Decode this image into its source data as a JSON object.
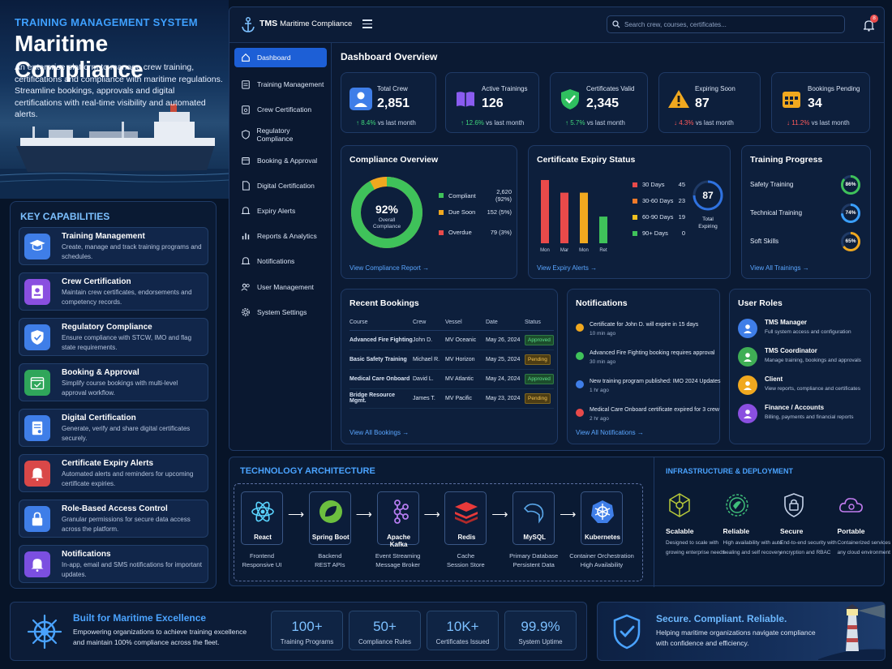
{
  "hero": {
    "subtitle": "TRAINING MANAGEMENT SYSTEM",
    "title": "Maritime Compliance",
    "description": "An enterprise platform to manage crew training, certifications and compliance with maritime regulations. Streamline bookings, approvals and digital certifications with real-time visibility and automated alerts."
  },
  "capabilities": {
    "title": "KEY CAPABILITIES",
    "items": [
      {
        "title": "Training Management",
        "desc": "Create, manage and track training programs and schedules.",
        "icon": "graduation-cap-icon",
        "color": "#3f7ee8"
      },
      {
        "title": "Crew Certification",
        "desc": "Maintain crew certificates, endorsements and competency records.",
        "icon": "id-card-icon",
        "color": "#8a4fe0"
      },
      {
        "title": "Regulatory Compliance",
        "desc": "Ensure compliance with STCW, IMO and flag state requirements.",
        "icon": "shield-check-icon",
        "color": "#3f7ee8"
      },
      {
        "title": "Booking & Approval",
        "desc": "Simplify course bookings with multi-level approval workflow.",
        "icon": "calendar-check-icon",
        "color": "#2fa65a"
      },
      {
        "title": "Digital Certification",
        "desc": "Generate, verify and share digital certificates securely.",
        "icon": "certificate-icon",
        "color": "#3f7ee8"
      },
      {
        "title": "Certificate Expiry Alerts",
        "desc": "Automated alerts and reminders for upcoming certificate expiries.",
        "icon": "bell-icon",
        "color": "#d94848"
      },
      {
        "title": "Role-Based Access Control",
        "desc": "Granular permissions for secure data access across the platform.",
        "icon": "lock-icon",
        "color": "#3f7ee8"
      },
      {
        "title": "Notifications",
        "desc": "In-app, email and SMS notifications for important updates.",
        "icon": "bell-icon",
        "color": "#7b4fe0"
      }
    ]
  },
  "app": {
    "brand_prefix": "TMS",
    "brand": "Maritime Compliance",
    "search_placeholder": "Search crew, courses, certificates...",
    "notification_count": "8",
    "nav": [
      {
        "label": "Dashboard",
        "icon": "home-icon",
        "active": true
      },
      {
        "label": "Training Management",
        "icon": "clipboard-icon"
      },
      {
        "label": "Crew Certification",
        "icon": "certificate-icon"
      },
      {
        "label": "Regulatory Compliance",
        "icon": "shield-icon"
      },
      {
        "label": "Booking & Approval",
        "icon": "calendar-icon"
      },
      {
        "label": "Digital Certification",
        "icon": "document-icon"
      },
      {
        "label": "Expiry Alerts",
        "icon": "bell-icon"
      },
      {
        "label": "Reports & Analytics",
        "icon": "bar-chart-icon"
      },
      {
        "label": "Notifications",
        "icon": "bell-icon"
      },
      {
        "label": "User Management",
        "icon": "users-icon"
      },
      {
        "label": "System Settings",
        "icon": "gear-icon"
      }
    ],
    "dashboard_title": "Dashboard Overview",
    "stats": [
      {
        "label": "Total Crew",
        "value": "2,851",
        "delta": "8.4%",
        "dir": "up",
        "suffix": "vs last month",
        "icon": "user-icon",
        "color": "#3f7ee8"
      },
      {
        "label": "Active Trainings",
        "value": "126",
        "delta": "12.6%",
        "dir": "up",
        "suffix": "vs last month",
        "icon": "book-icon",
        "color": "#8a5cf0"
      },
      {
        "label": "Certificates Valid",
        "value": "2,345",
        "delta": "5.7%",
        "dir": "up",
        "suffix": "vs last month",
        "icon": "shield-check-icon",
        "color": "#2fbf5f"
      },
      {
        "label": "Expiring Soon",
        "value": "87",
        "delta": "4.3%",
        "dir": "down",
        "suffix": "vs last month",
        "icon": "warning-icon",
        "color": "#f0a81f"
      },
      {
        "label": "Bookings Pending",
        "value": "34",
        "delta": "11.2%",
        "dir": "down",
        "suffix": "vs last month",
        "icon": "calendar-icon",
        "color": "#f0a81f"
      }
    ],
    "compliance": {
      "title": "Compliance Overview",
      "percent": "92%",
      "center_label_1": "Overall",
      "center_label_2": "Compliance",
      "link": "View Compliance Report",
      "legend": [
        {
          "label": "Compliant",
          "value": "2,620 (92%)",
          "color": "#3fc25a"
        },
        {
          "label": "Due Soon",
          "value": "152 (5%)",
          "color": "#f0a81f"
        },
        {
          "label": "Overdue",
          "value": "79 (3%)",
          "color": "#e84a4a"
        }
      ]
    },
    "expiry": {
      "title": "Certificate Expiry Status",
      "total": "87",
      "total_label_1": "Total",
      "total_label_2": "Expiring",
      "link": "View Expiry Alerts",
      "bars": [
        {
          "tick": "Mon",
          "value": 45,
          "color": "#e84a4a"
        },
        {
          "tick": "Mar",
          "value": 36,
          "color": "#e84a4a"
        },
        {
          "tick": "Mon",
          "value": 36,
          "color": "#f0a81f"
        },
        {
          "tick": "Ret",
          "value": 19,
          "color": "#3fc25a"
        }
      ],
      "legend": [
        {
          "label": "30 Days",
          "value": "45",
          "color": "#e84a4a"
        },
        {
          "label": "30-60 Days",
          "value": "23",
          "color": "#f07a2a"
        },
        {
          "label": "60-90 Days",
          "value": "19",
          "color": "#f0c020"
        },
        {
          "label": "90+ Days",
          "value": "0",
          "color": "#3fc25a"
        }
      ]
    },
    "training_progress": {
      "title": "Training Progress",
      "link": "View All Trainings",
      "items": [
        {
          "label": "Safety Training",
          "percent": "86%",
          "fraction": 0.86,
          "color": "#3fc25a"
        },
        {
          "label": "Technical Training",
          "percent": "74%",
          "fraction": 0.74,
          "color": "#3aa0ff"
        },
        {
          "label": "Soft Skills",
          "percent": "65%",
          "fraction": 0.65,
          "color": "#f0a81f"
        }
      ]
    },
    "bookings": {
      "title": "Recent Bookings",
      "link": "View All Bookings",
      "headers": [
        "Course",
        "Crew",
        "Vessel",
        "Date",
        "Status"
      ],
      "rows": [
        {
          "course": "Advanced Fire Fighting",
          "crew": "John D.",
          "vessel": "MV Oceanic",
          "date": "May 26, 2024",
          "status": "Approved"
        },
        {
          "course": "Basic Safety Training",
          "crew": "Michael R.",
          "vessel": "MV Horizon",
          "date": "May 25, 2024",
          "status": "Pending"
        },
        {
          "course": "Medical Care Onboard",
          "crew": "David L.",
          "vessel": "MV Atlantic",
          "date": "May 24, 2024",
          "status": "Approved"
        },
        {
          "course": "Bridge Resource Mgmt.",
          "crew": "James T.",
          "vessel": "MV Pacific",
          "date": "May 23, 2024",
          "status": "Pending"
        }
      ]
    },
    "notifications": {
      "title": "Notifications",
      "link": "View All Notifications",
      "items": [
        {
          "text": "Certificate for John D. will expire in 15 days",
          "time": "10 min ago",
          "color": "#f0a81f"
        },
        {
          "text": "Advanced Fire Fighting booking requires approval",
          "time": "30 min ago",
          "color": "#3fc25a"
        },
        {
          "text": "New training program published: IMO 2024 Updates",
          "time": "1 hr ago",
          "color": "#3f7ee8"
        },
        {
          "text": "Medical Care Onboard certificate expired for 3 crew",
          "time": "2 hr ago",
          "color": "#e84a4a"
        }
      ]
    },
    "roles": {
      "title": "User Roles",
      "items": [
        {
          "title": "TMS Manager",
          "desc": "Full system access and configuration",
          "color": "#3f7ee8"
        },
        {
          "title": "TMS Coordinator",
          "desc": "Manage training, bookings and approvals",
          "color": "#3fae55"
        },
        {
          "title": "Client",
          "desc": "View reports, compliance and certificates",
          "color": "#f0a81f"
        },
        {
          "title": "Finance / Accounts",
          "desc": "Billing, payments and financial reports",
          "color": "#8a4fe0"
        }
      ]
    }
  },
  "tech": {
    "title": "TECHNOLOGY ARCHITECTURE",
    "items": [
      {
        "name": "React",
        "line1": "Frontend",
        "line2": "Responsive UI",
        "icon": "react-icon",
        "color": "#5ad4ff"
      },
      {
        "name": "Spring Boot",
        "line1": "Backend",
        "line2": "REST APIs",
        "icon": "spring-leaf-icon",
        "color": "#6cbf3f"
      },
      {
        "name": "Apache Kafka",
        "line1": "Event Streaming",
        "line2": "Message Broker",
        "icon": "kafka-icon",
        "color": "#b57cf0"
      },
      {
        "name": "Redis",
        "line1": "Cache",
        "line2": "Session Store",
        "icon": "redis-icon",
        "color": "#e83a3a"
      },
      {
        "name": "MySQL",
        "line1": "Primary Database",
        "line2": "Persistent Data",
        "icon": "dolphin-icon",
        "color": "#5aa6e8"
      },
      {
        "name": "Kubernetes",
        "line1": "Container Orchestration",
        "line2": "High Availability",
        "icon": "kubernetes-icon",
        "color": "#3f7ee8"
      }
    ]
  },
  "infra": {
    "title": "INFRASTRUCTURE & DEPLOYMENT",
    "items": [
      {
        "title": "Scalable",
        "desc": "Designed to scale with growing enterprise needs",
        "icon": "network-icon",
        "color": "#b8c93a"
      },
      {
        "title": "Reliable",
        "desc": "High availability with auto healing and self recovery",
        "icon": "reliable-icon",
        "color": "#3fbf7a"
      },
      {
        "title": "Secure",
        "desc": "End-to-end security with encryption and RBAC",
        "icon": "lock-shield-icon",
        "color": "#c5d2e8"
      },
      {
        "title": "Portable",
        "desc": "Containerized services for any cloud environment",
        "icon": "cloud-icon",
        "color": "#c27cf0"
      }
    ]
  },
  "maritime": {
    "title": "Built for Maritime Excellence",
    "desc": "Empowering organizations to achieve training excellence and maintain 100% compliance across the fleet.",
    "metrics": [
      {
        "value": "100+",
        "label": "Training Programs"
      },
      {
        "value": "50+",
        "label": "Compliance Rules"
      },
      {
        "value": "10K+",
        "label": "Certificates Issued"
      },
      {
        "value": "99.9%",
        "label": "System Uptime"
      }
    ]
  },
  "secure": {
    "title": "Secure. Compliant. Reliable.",
    "desc": "Helping maritime organizations navigate compliance with confidence and efficiency."
  }
}
